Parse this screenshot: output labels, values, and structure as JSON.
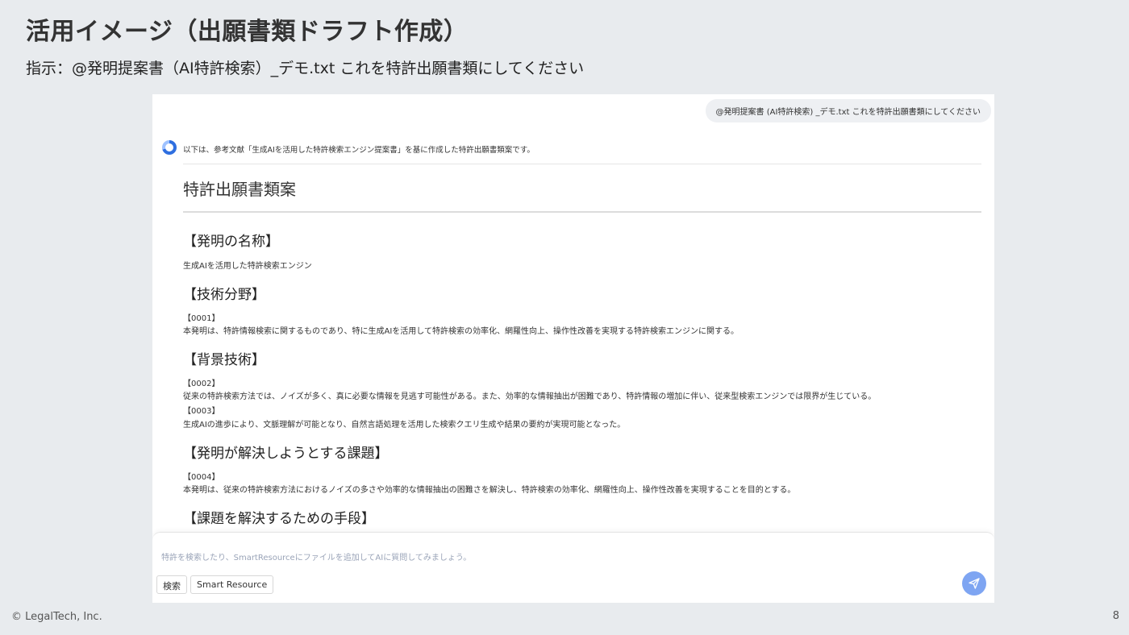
{
  "slide": {
    "title": "活用イメージ（出願書類ドラフト作成）",
    "instruction": "指示：@発明提案書（AI特許検索）_デモ.txt これを特許出願書類にしてください"
  },
  "chat": {
    "user_message": "@発明提案書 (AI特許検索) _デモ.txt これを特許出願書類にしてください",
    "assistant_intro": "以下は、参考文献「生成AIを活用した特許検索エンジン提案書」を基に作成した特許出願書類案です。",
    "document": {
      "title": "特許出願書類案",
      "sections": [
        {
          "heading": "【発明の名称】",
          "text": "生成AIを活用した特許検索エンジン"
        },
        {
          "heading": "【技術分野】",
          "num1": "【0001】",
          "text1": "本発明は、特許情報検索に関するものであり、特に生成AIを活用して特許検索の効率化、網羅性向上、操作性改善を実現する特許検索エンジンに関する。"
        },
        {
          "heading": "【背景技術】",
          "num1": "【0002】",
          "text1": "従来の特許検索方法では、ノイズが多く、真に必要な情報を見逃す可能性がある。また、効率的な情報抽出が困難であり、特許情報の増加に伴い、従来型検索エンジンでは限界が生じている。",
          "num2": "【0003】",
          "text2": "生成AIの進歩により、文脈理解が可能となり、自然言語処理を活用した検索クエリ生成や結果の要約が実現可能となった。"
        },
        {
          "heading": "【発明が解決しようとする課題】",
          "num1": "【0004】",
          "text1": "本発明は、従来の特許検索方法におけるノイズの多さや効率的な情報抽出の困難さを解決し、特許検索の効率化、網羅性向上、操作性改善を実現することを目的とする。"
        },
        {
          "heading": "【課題を解決するための手段】"
        }
      ]
    }
  },
  "input": {
    "placeholder": "特許を検索したり、SmartResourceにファイルを追加してAIに質問してみましょう。",
    "chips": [
      "検索",
      "Smart Resource"
    ]
  },
  "footer": {
    "copyright": "© LegalTech, Inc.",
    "page": "8"
  },
  "colors": {
    "background": "#e8ebee",
    "send_button": "#7ea5f2",
    "accent": "#2f6fe0"
  },
  "icons": [
    "assistant-logo-icon",
    "send-icon"
  ]
}
